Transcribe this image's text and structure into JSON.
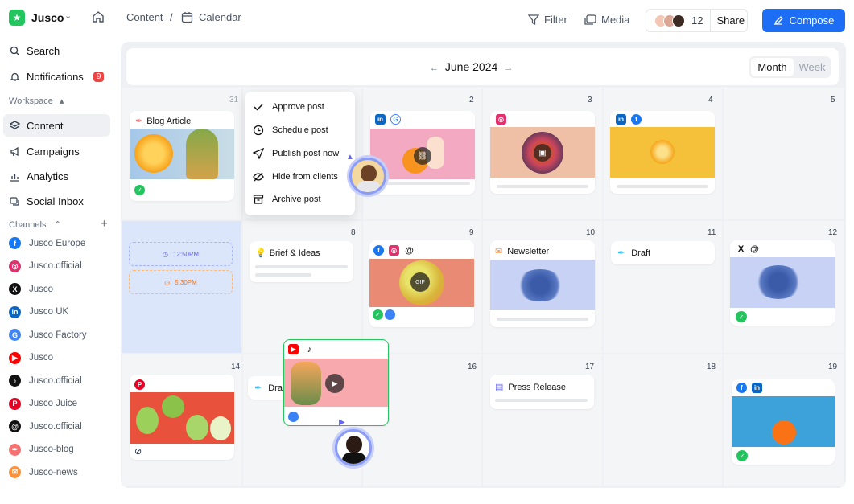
{
  "workspace": {
    "name": "Jusco"
  },
  "nav": [
    {
      "label": "Search"
    },
    {
      "label": "Notifications",
      "badge": "9"
    }
  ],
  "workspace_section": "Workspace",
  "workspace_nav": [
    {
      "label": "Content"
    },
    {
      "label": "Campaigns"
    },
    {
      "label": "Analytics"
    },
    {
      "label": "Social Inbox"
    }
  ],
  "channels_section": "Channels",
  "channels": [
    {
      "label": "Jusco Europe",
      "icon": "facebook-icon",
      "color": "#1877f2"
    },
    {
      "label": "Jusco.official",
      "icon": "instagram-icon",
      "color": "#e1306c"
    },
    {
      "label": "Jusco",
      "icon": "x-icon",
      "color": "#111111"
    },
    {
      "label": "Jusco UK",
      "icon": "linkedin-icon",
      "color": "#0a66c2"
    },
    {
      "label": "Jusco Factory",
      "icon": "google-icon",
      "color": "#4285f4"
    },
    {
      "label": "Jusco",
      "icon": "youtube-icon",
      "color": "#ff0000"
    },
    {
      "label": "Jusco.official",
      "icon": "tiktok-icon",
      "color": "#111111"
    },
    {
      "label": "Jusco Juice",
      "icon": "pinterest-icon",
      "color": "#e60023"
    },
    {
      "label": "Jusco.official",
      "icon": "threads-icon",
      "color": "#111111"
    },
    {
      "label": "Jusco-blog",
      "icon": "blog-icon",
      "color": "#f87171"
    },
    {
      "label": "Jusco-news",
      "icon": "newsletter-icon",
      "color": "#fb923c"
    }
  ],
  "breadcrumb": {
    "root": "Content",
    "sep": "/",
    "current": "Calendar"
  },
  "header": {
    "filter": "Filter",
    "media": "Media",
    "members_count": "12",
    "share": "Share",
    "compose": "Compose"
  },
  "calendar": {
    "prev": "←",
    "month": "June 2024",
    "next": "→",
    "view_month": "Month",
    "view_week": "Week"
  },
  "days": {
    "d31": "31",
    "d2": "2",
    "d3": "3",
    "d4": "4",
    "d5": "5",
    "d8": "8",
    "d9": "9",
    "d10": "10",
    "d11": "11",
    "d12": "12",
    "d14": "14",
    "d16": "16",
    "d17": "17",
    "d18": "18",
    "d19": "19"
  },
  "time_slots": {
    "t1": "12:50PM",
    "t2": "5:30PM"
  },
  "cards": {
    "blog": "Blog Article",
    "brief": "Brief & Ideas",
    "newsletter": "Newsletter",
    "draft": "Draft",
    "press": "Press Release",
    "draft2": "Dra",
    "gif": "GIF"
  },
  "menu": [
    {
      "label": "Approve post"
    },
    {
      "label": "Schedule post"
    },
    {
      "label": "Publish post now"
    },
    {
      "label": "Hide from clients"
    },
    {
      "label": "Archive post"
    }
  ],
  "colors": {
    "accent": "#1d6ef5",
    "badge": "#ef4444",
    "approved": "#22c55e"
  }
}
